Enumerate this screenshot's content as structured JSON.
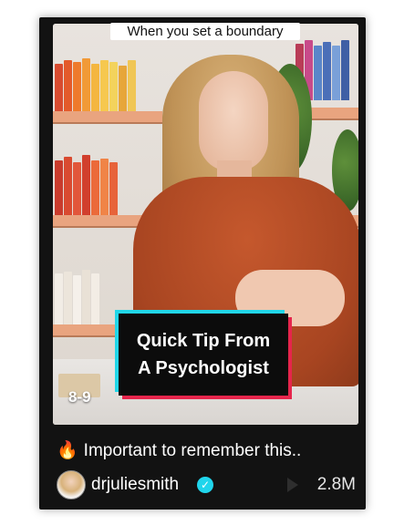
{
  "video": {
    "top_caption": "When you set a boundary",
    "tip_line1": "Quick Tip From",
    "tip_line2": "A Psychologist",
    "index_label": "8-9"
  },
  "post": {
    "emoji": "🔥",
    "description": "Important to remember this..",
    "username": "drjuliesmith",
    "verified_glyph": "✓",
    "views": "2.8M"
  },
  "colors": {
    "card_background": "#121212",
    "tip_cyan": "#21d6e8",
    "tip_red": "#e6254c",
    "verified_badge": "#20d5ec"
  },
  "icons": [
    "fire-icon",
    "verified-icon",
    "play-icon"
  ]
}
